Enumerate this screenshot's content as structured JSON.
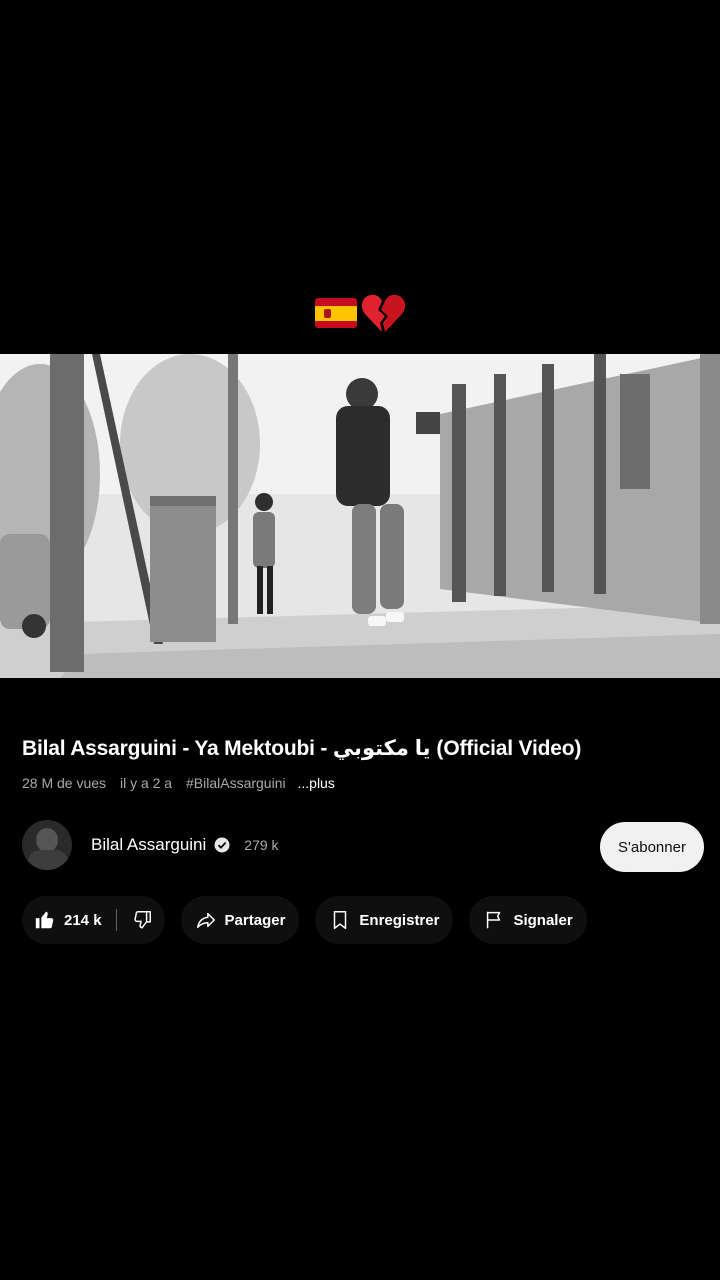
{
  "overlay": {
    "emojis": [
      "spain-flag",
      "broken-heart"
    ]
  },
  "video": {
    "title": "Bilal Assarguini - Ya Mektoubi - يا مكتوبي (Official Video)",
    "views": "28 M de vues",
    "age": "il y a 2 a",
    "hashtag": "#BilalAssarguini",
    "more": "...plus"
  },
  "channel": {
    "name": "Bilal Assarguini",
    "subscribers": "279 k",
    "subscribe_label": "S'abonner",
    "verified": true
  },
  "actions": {
    "likes": "214 k",
    "share": "Partager",
    "save": "Enregistrer",
    "report": "Signaler"
  },
  "colors": {
    "background": "#000000",
    "pill_bg": "#0f0f0f",
    "subscribe_bg": "#f1f1f1",
    "secondary_text": "#aaaaaa"
  }
}
